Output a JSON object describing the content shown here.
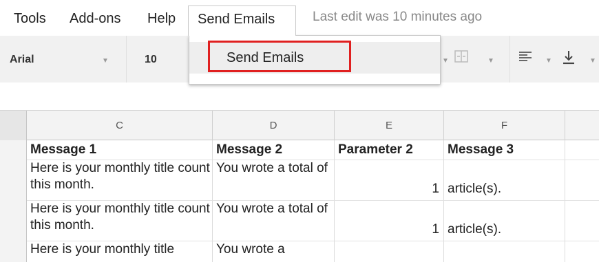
{
  "menubar": {
    "items": [
      "Tools",
      "Add-ons",
      "Help"
    ],
    "active": "Send Emails",
    "last_edit": "Last edit was 10 minutes ago"
  },
  "toolbar": {
    "font": "Arial",
    "font_size": "10",
    "icons": [
      "merge-cells-icon",
      "align-left-icon",
      "align-bottom-icon"
    ]
  },
  "dropdown": {
    "items": [
      "Send Emails"
    ],
    "highlight_color": "#e02020"
  },
  "sheet": {
    "columns": [
      "C",
      "D",
      "E",
      "F"
    ],
    "headers": [
      "Message 1",
      "Message 2",
      "Parameter 2",
      "Message 3"
    ],
    "rows": [
      {
        "c": "Here is your monthly title count this month.",
        "d": "You wrote a total of",
        "e": "1",
        "f": "article(s)."
      },
      {
        "c": "Here is your monthly title count this month.",
        "d": "You wrote a total of",
        "e": "1",
        "f": "article(s)."
      },
      {
        "c": "Here is your monthly title",
        "d": "You wrote a",
        "e": "",
        "f": ""
      }
    ]
  }
}
